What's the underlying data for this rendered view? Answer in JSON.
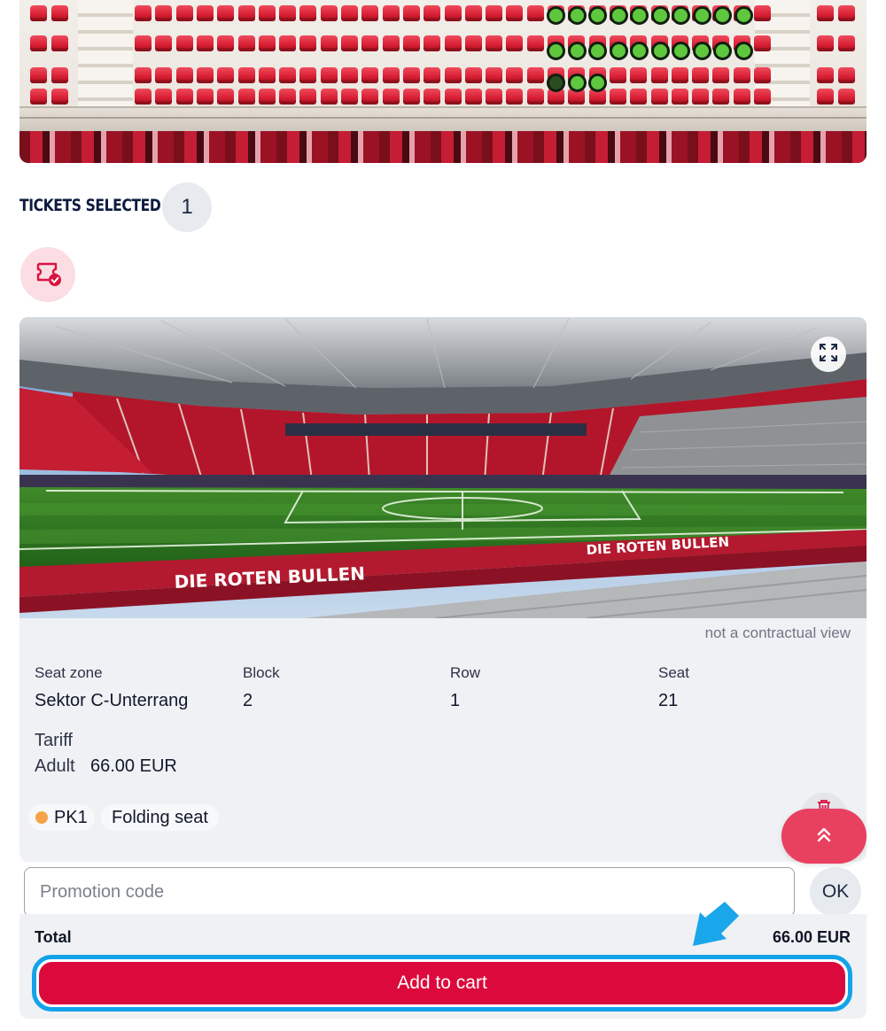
{
  "seatmap": {
    "selected_row1_seats": 10,
    "selected_row2_seats": 10,
    "selected_row3_seats": 3
  },
  "tickets": {
    "heading": "TICKETS SELECTED",
    "count": "1"
  },
  "stadium_view": {
    "banner_text_left": "DIE ROTEN BULLEN",
    "banner_text_right": "DIE ROTEN BULLEN",
    "disclaimer": "not a contractual view"
  },
  "seat_info": {
    "zone_label": "Seat zone",
    "zone_value": "Sektor C-Unterrang",
    "block_label": "Block",
    "block_value": "2",
    "row_label": "Row",
    "row_value": "1",
    "seat_label": "Seat",
    "seat_value": "21",
    "tariff_label": "Tariff",
    "tariff_type": "Adult",
    "tariff_price": "66.00 EUR",
    "category": "PK1",
    "category_color": "#f7a248",
    "seat_type": "Folding seat"
  },
  "promotion": {
    "placeholder": "Promotion code",
    "ok_label": "OK"
  },
  "checkout": {
    "total_label": "Total",
    "total_value": "66.00 EUR",
    "add_to_cart_label": "Add to cart"
  },
  "colors": {
    "brand_red": "#dc0a3c",
    "focus_blue": "#13a3e8",
    "scroll_button": "#e8405f"
  }
}
